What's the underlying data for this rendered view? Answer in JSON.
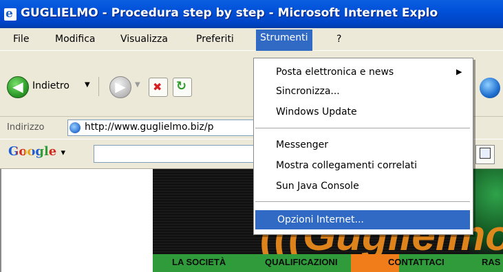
{
  "window": {
    "title": "GUGLIELMO - Procedura step by step - Microsoft Internet Explo"
  },
  "menubar": {
    "items": [
      "File",
      "Modifica",
      "Visualizza",
      "Preferiti",
      "Strumenti",
      "?"
    ],
    "active": "Strumenti"
  },
  "toolbar": {
    "back_label": "Indietro",
    "back_icon": "green-left-arrow-icon",
    "forward_icon": "gray-right-arrow-icon",
    "stop_icon": "stop-x-icon",
    "refresh_icon": "refresh-icon"
  },
  "address_bar": {
    "label": "Indirizzo",
    "url": "http://www.guglielmo.biz/p"
  },
  "google_bar": {
    "logo": "Google",
    "dropdown_arrow": "▾"
  },
  "dropdown": {
    "items": [
      {
        "label": "Posta elettronica e news",
        "has_submenu": true
      },
      {
        "label": "Sincronizza..."
      },
      {
        "label": "Windows Update"
      },
      {
        "label": "Messenger"
      },
      {
        "label": "Mostra collegamenti correlati"
      },
      {
        "label": "Sun Java Console"
      },
      {
        "label": "Opzioni Internet...",
        "selected": true
      }
    ],
    "submenu_arrow": "▶"
  },
  "page": {
    "nav_tabs": [
      "LA SOCIETÀ",
      "QUALIFICAZIONI",
      "CONTATTACI",
      "RAS"
    ],
    "banner_text": "(((Guglielmo)"
  },
  "colors": {
    "titlebar": "#0050d8",
    "selection": "#316ac5",
    "menu_bg": "#ece9d8",
    "nav_green": "#2f9b3a",
    "nav_orange": "#f07c1a",
    "banner_orange": "#e98a1c"
  }
}
